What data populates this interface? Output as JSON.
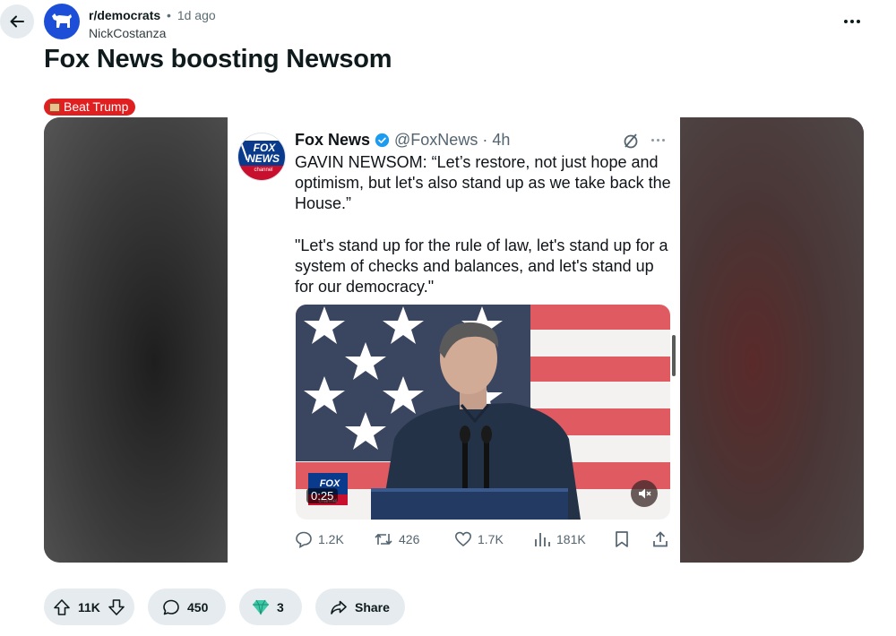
{
  "header": {
    "subreddit": "r/democrats",
    "separator": "•",
    "age": "1d ago",
    "author": "NickCostanza"
  },
  "post": {
    "title": "Fox News boosting Newsom",
    "flair": "Beat Trump",
    "flair_color": "#e02020"
  },
  "tweet": {
    "display_name": "Fox News",
    "handle": "@FoxNews",
    "separator": "·",
    "age": "4h",
    "logo_text_top": "FOX",
    "logo_text_mid": "NEWS",
    "logo_text_bottom": "channel",
    "paragraph_1": "GAVIN NEWSOM: “Let’s restore, not just hope and optimism, but let's also stand up as we take back the House.”",
    "paragraph_2": "\"Let's stand up for the rule of law, let's stand up for a system of checks and balances, and let's stand up for our democracy.\"",
    "video": {
      "duration": "0:25",
      "muted": true
    },
    "stats": {
      "replies": "1.2K",
      "reposts": "426",
      "likes": "1.7K",
      "views": "181K"
    },
    "accent_color": "#1d9bf0"
  },
  "actions": {
    "upvotes": "11K",
    "comments": "450",
    "awards": "3",
    "share_label": "Share"
  }
}
